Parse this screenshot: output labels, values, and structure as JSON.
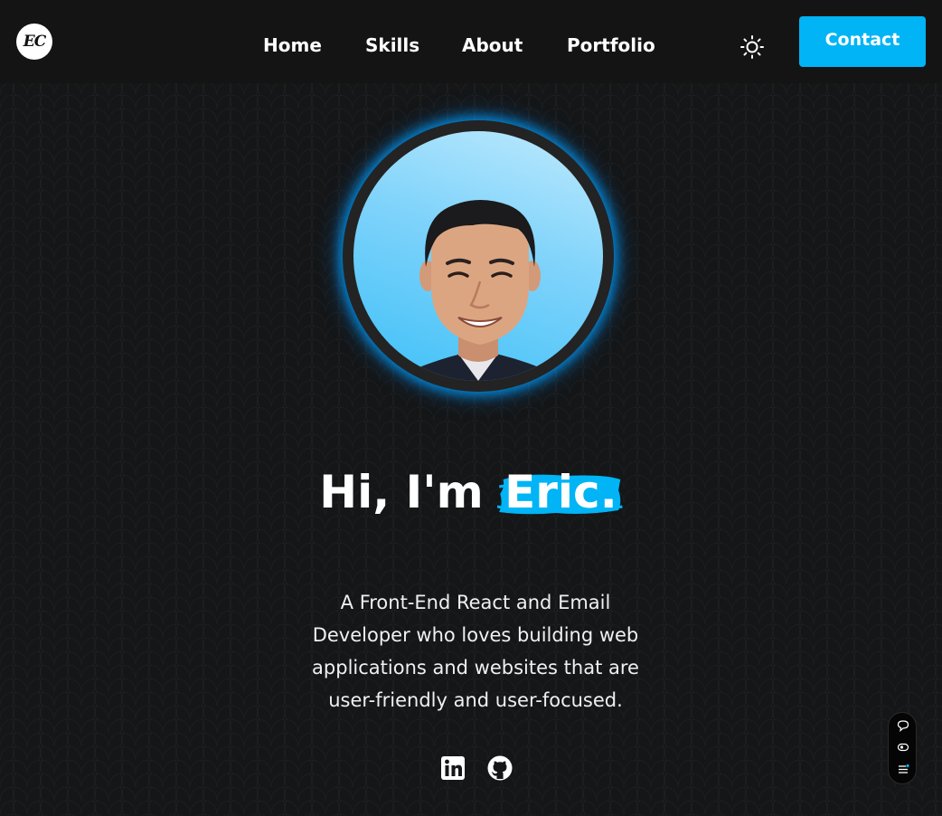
{
  "header": {
    "logo_text": "EC",
    "nav": [
      {
        "label": "Home"
      },
      {
        "label": "Skills"
      },
      {
        "label": "About"
      },
      {
        "label": "Portfolio"
      }
    ],
    "theme_icon": "sun-icon",
    "contact_label": "Contact"
  },
  "hero": {
    "greeting": "Hi, I'm",
    "name": "Eric.",
    "tagline_lines": [
      "A Front-End React and Email",
      "Developer who loves building web",
      "applications and websites that are",
      "user-friendly and user-focused."
    ],
    "socials": [
      {
        "icon": "linkedin-icon"
      },
      {
        "icon": "github-icon"
      }
    ]
  },
  "side_widget": {
    "icons": [
      "chat-bubble-icon",
      "eye-icon",
      "menu-list-icon"
    ]
  },
  "colors": {
    "accent": "#00b4f5",
    "background": "#141617",
    "header": "#141414"
  }
}
